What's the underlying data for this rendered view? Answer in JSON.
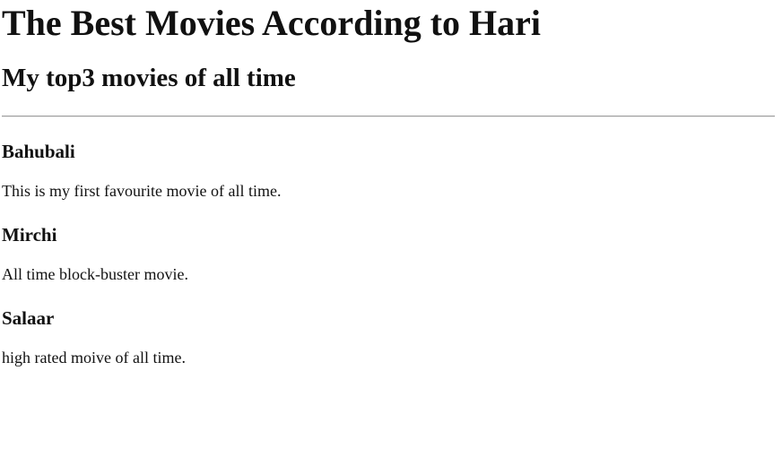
{
  "page": {
    "title": "The Best Movies According to Hari",
    "subtitle": "My top3 movies of all time"
  },
  "movies": [
    {
      "name": "Bahubali",
      "description": "This is my first favourite movie of all time."
    },
    {
      "name": "Mirchi",
      "description": "All time block-buster movie."
    },
    {
      "name": "Salaar",
      "description": "high rated moive of all time."
    }
  ]
}
